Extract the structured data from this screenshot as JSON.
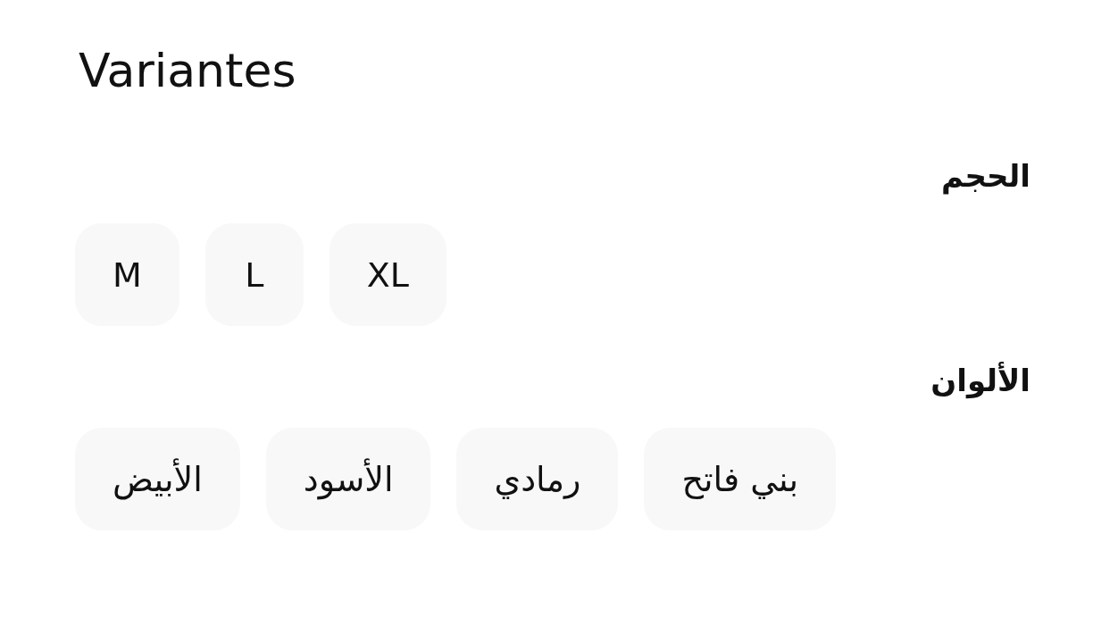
{
  "title": "Variantes",
  "sections": [
    {
      "label": "الحجم",
      "options": [
        {
          "label": "XL"
        },
        {
          "label": "L"
        },
        {
          "label": "M"
        }
      ]
    },
    {
      "label": "الألوان",
      "options": [
        {
          "label": "بني فاتح"
        },
        {
          "label": "رمادي"
        },
        {
          "label": "الأسود"
        },
        {
          "label": "الأبيض"
        }
      ]
    }
  ]
}
